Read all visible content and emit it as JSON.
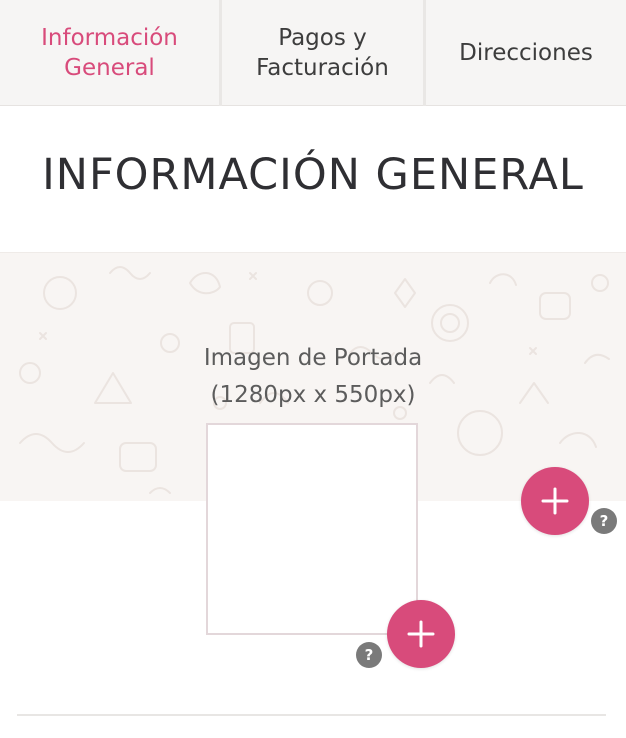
{
  "tabs": [
    {
      "label": "Información\nGeneral",
      "active": true
    },
    {
      "label": "Pagos y\nFacturación",
      "active": false
    },
    {
      "label": "Direcciones",
      "active": false
    }
  ],
  "section_title": "INFORMACIÓN GENERAL",
  "cover": {
    "caption_line1": "Imagen de Portada",
    "caption_line2": "(1280px x 550px)",
    "add_icon": "plus-icon",
    "help_icon": "question-icon",
    "help_glyph": "?"
  },
  "profile": {
    "add_icon": "plus-icon",
    "help_icon": "question-icon",
    "help_glyph": "?"
  },
  "colors": {
    "accent": "#d84b7b",
    "tab_bg": "#f6f5f4",
    "cover_bg": "#f8f5f3",
    "help_bg": "#7a7a7a"
  }
}
